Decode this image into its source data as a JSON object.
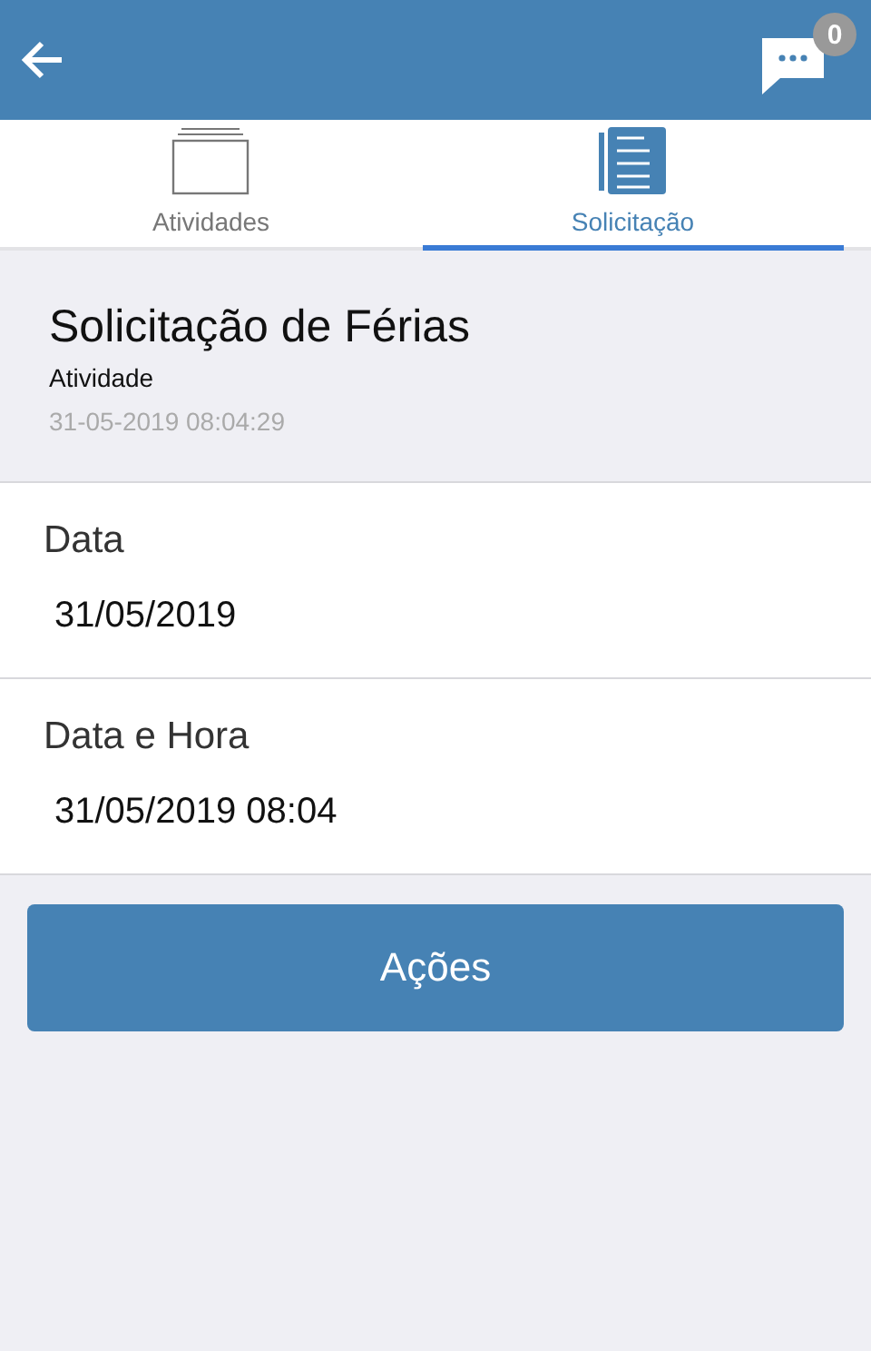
{
  "header": {
    "badge": "0"
  },
  "tabs": [
    {
      "label": "Atividades",
      "kind": "folder",
      "selected": false
    },
    {
      "label": "Solicitação",
      "kind": "document",
      "selected": true
    }
  ],
  "request": {
    "title": "Solicitação de Férias",
    "subtitle": "Atividade",
    "timestamp": "31-05-2019 08:04:29"
  },
  "fields": [
    {
      "label": "Data",
      "value": "31/05/2019"
    },
    {
      "label": "Data e Hora",
      "value": "31/05/2019 08:04"
    }
  ],
  "action_button": "Ações"
}
